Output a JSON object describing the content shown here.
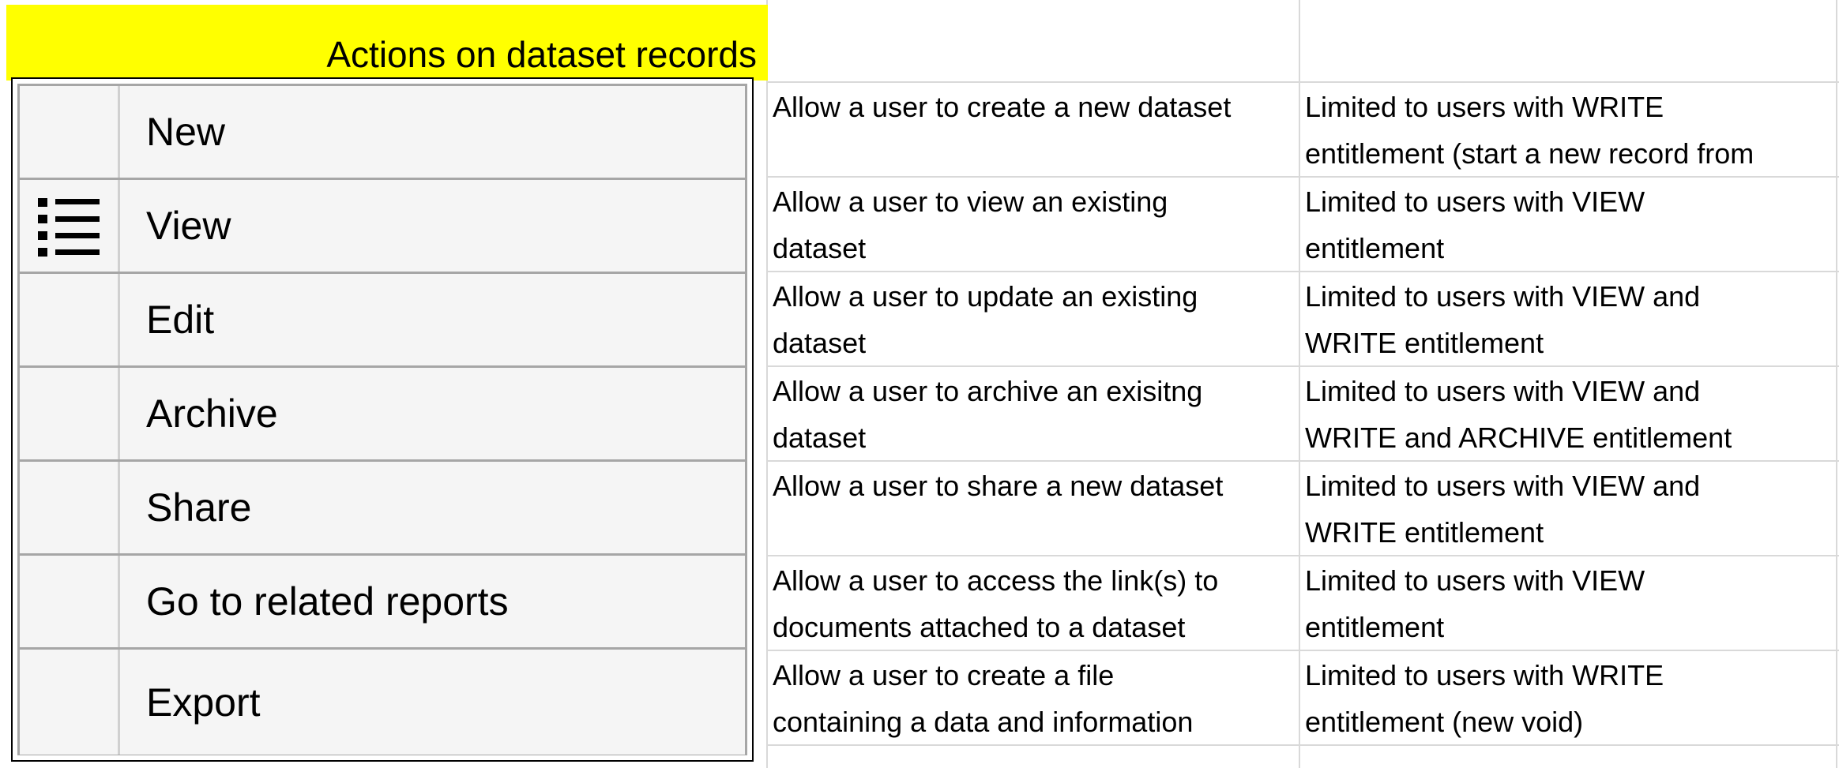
{
  "header": {
    "title": "Actions on dataset records"
  },
  "menu": {
    "items": [
      {
        "label": "New",
        "icon": ""
      },
      {
        "label": "View",
        "icon": "list-icon"
      },
      {
        "label": "Edit",
        "icon": ""
      },
      {
        "label": "Archive",
        "icon": ""
      },
      {
        "label": "Share",
        "icon": ""
      },
      {
        "label": "Go to related reports",
        "icon": ""
      },
      {
        "label": "Export",
        "icon": ""
      }
    ]
  },
  "table": {
    "rows": [
      {
        "description": [
          "Allow a user to create a new dataset",
          ""
        ],
        "limit": [
          "Limited to users with WRITE",
          "entitlement (start a new record from"
        ]
      },
      {
        "description": [
          "Allow a user to view an existing",
          "dataset"
        ],
        "limit": [
          "Limited to users with VIEW",
          "entitlement"
        ]
      },
      {
        "description": [
          "Allow a user to update an existing",
          "dataset"
        ],
        "limit": [
          "Limited to users with VIEW and",
          "WRITE entitlement"
        ]
      },
      {
        "description": [
          "Allow a user to archive an exisitng",
          "dataset"
        ],
        "limit": [
          "Limited to users with VIEW and",
          "WRITE and ARCHIVE  entitlement"
        ]
      },
      {
        "description": [
          "Allow a user to share a new dataset",
          ""
        ],
        "limit": [
          "Limited to users with VIEW and",
          "WRITE entitlement"
        ]
      },
      {
        "description": [
          "Allow a user to access the link(s) to",
          "documents attached to a dataset"
        ],
        "limit": [
          "Limited to users with VIEW",
          "entitlement"
        ]
      },
      {
        "description": [
          "Allow a user to create a file",
          "containing a data and information"
        ],
        "limit": [
          "Limited to users with WRITE",
          "entitlement (new void)"
        ]
      }
    ]
  }
}
